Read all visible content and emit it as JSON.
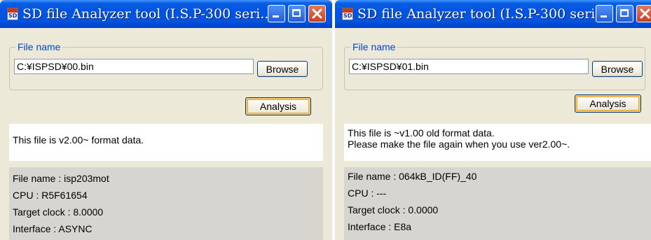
{
  "windows": [
    {
      "title": "SD file Analyzer tool (I.S.P-300 seri...",
      "app_icon_text": "SD",
      "file_group_label": "File name",
      "file_path": "C:¥ISPSD¥00.bin",
      "browse_label": "Browse",
      "analysis_label": "Analysis",
      "message_lines": [
        "This file is v2.00~ format data."
      ],
      "info": {
        "file_name": "File name : isp203mot",
        "cpu": "CPU : R5F61654",
        "target_clock": "Target clock : 8.0000",
        "interface": "Interface : ASYNC"
      }
    },
    {
      "title": "SD file Analyzer tool (I.S.P-300 seri...",
      "app_icon_text": "SD",
      "file_group_label": "File name",
      "file_path": "C:¥ISPSD¥01.bin",
      "browse_label": "Browse",
      "analysis_label": "Analysis",
      "message_lines": [
        "This file is ~v1.00 old format data.",
        "Please make the file again when you use ver2.00~."
      ],
      "info": {
        "file_name": "File name : 064kB_ID(FF)_40",
        "cpu": "CPU : ---",
        "target_clock": "Target clock : 0.0000",
        "interface": "Interface : E8a"
      }
    }
  ]
}
